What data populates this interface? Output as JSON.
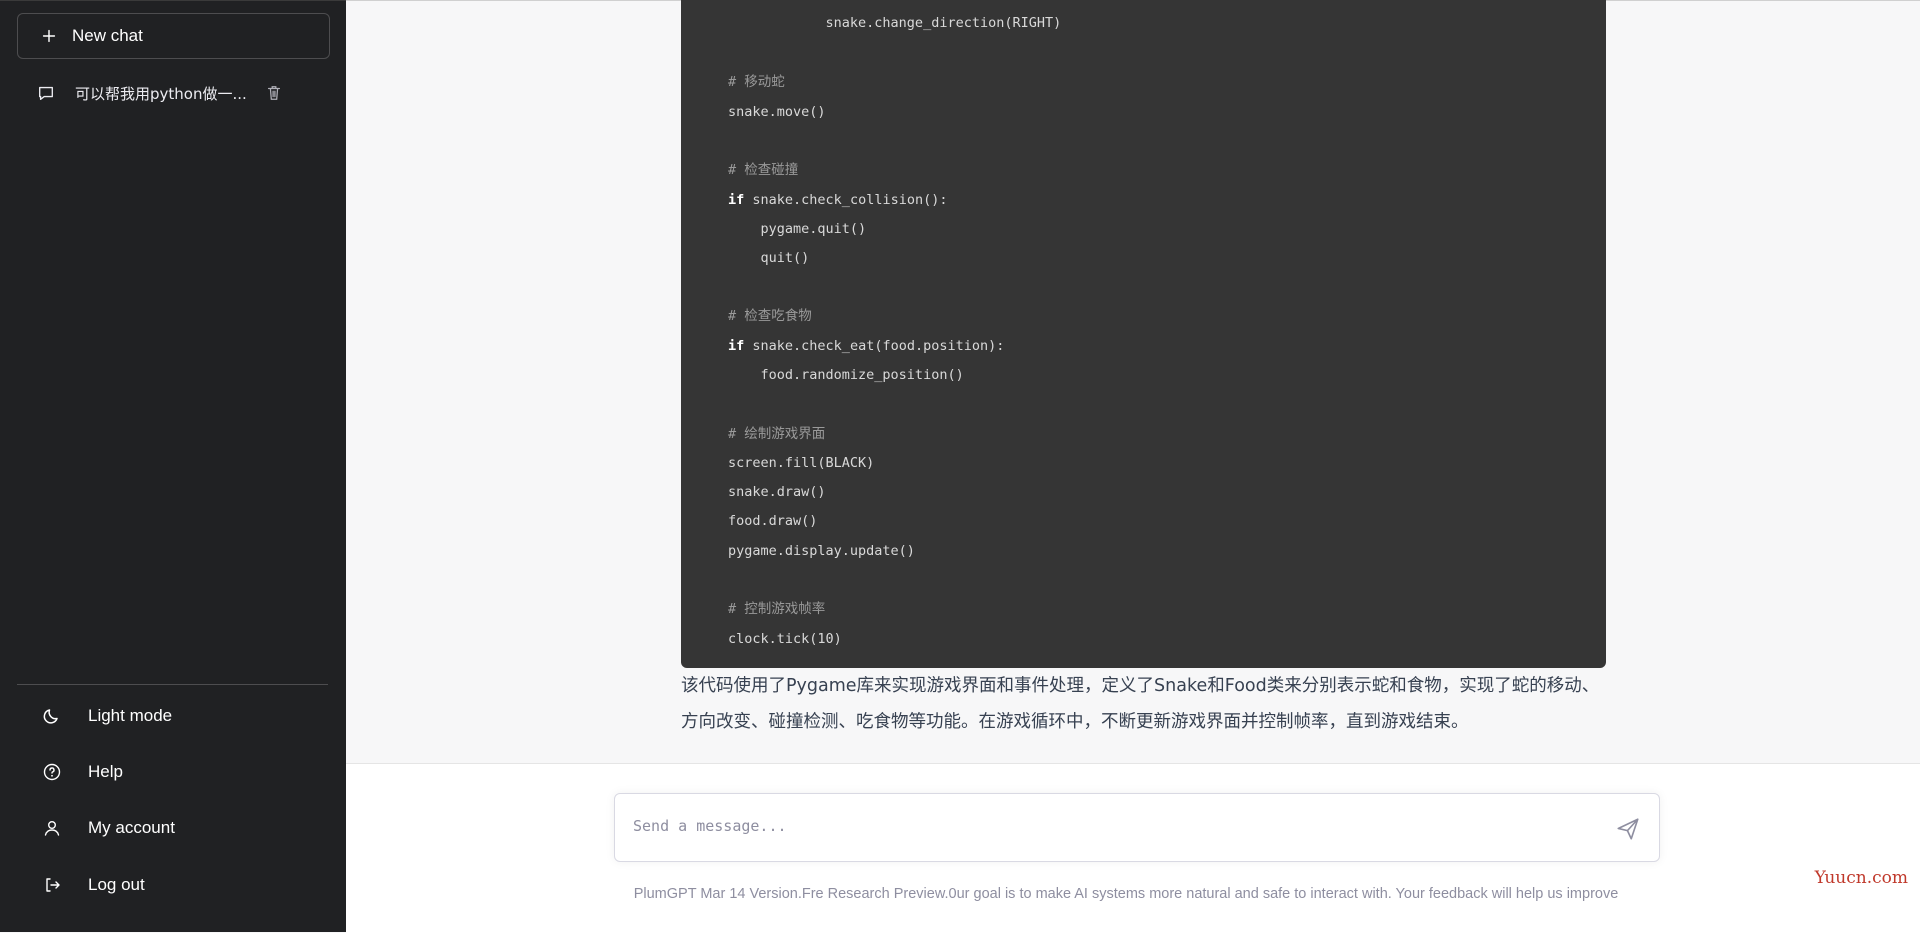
{
  "sidebar": {
    "new_chat_label": "New chat",
    "history": [
      {
        "title": "可以帮我用python做一...",
        "icon": "chat-bubble-icon",
        "action_icon": "trash-icon"
      }
    ],
    "bottom_items": [
      {
        "label": "Light mode",
        "icon": "moon-icon"
      },
      {
        "label": "Help",
        "icon": "help-circle-icon"
      },
      {
        "label": "My account",
        "icon": "user-icon"
      },
      {
        "label": "Log out",
        "icon": "logout-icon"
      }
    ]
  },
  "code": {
    "lines": [
      {
        "text": "            snake.change_direction(RIGHT)",
        "type": "code"
      },
      {
        "text": "",
        "type": "code"
      },
      {
        "text": "# 移动蛇",
        "type": "comment"
      },
      {
        "text": "snake.move()",
        "type": "code"
      },
      {
        "text": "",
        "type": "code"
      },
      {
        "text": "# 检查碰撞",
        "type": "comment"
      },
      {
        "text": "snake.check_collision():",
        "type": "if"
      },
      {
        "text": "    pygame.quit()",
        "type": "code"
      },
      {
        "text": "    quit()",
        "type": "code"
      },
      {
        "text": "",
        "type": "code"
      },
      {
        "text": "# 检查吃食物",
        "type": "comment"
      },
      {
        "text": "snake.check_eat(food.position):",
        "type": "if"
      },
      {
        "text": "    food.randomize_position()",
        "type": "code"
      },
      {
        "text": "",
        "type": "code"
      },
      {
        "text": "# 绘制游戏界面",
        "type": "comment"
      },
      {
        "text": "screen.fill(BLACK)",
        "type": "code"
      },
      {
        "text": "snake.draw()",
        "type": "code"
      },
      {
        "text": "food.draw()",
        "type": "code"
      },
      {
        "text": "pygame.display.update()",
        "type": "code"
      },
      {
        "text": "",
        "type": "code"
      },
      {
        "text": "# 控制游戏帧率",
        "type": "comment"
      },
      {
        "text": "clock.tick(10)",
        "type": "code"
      }
    ],
    "keyword": "if"
  },
  "answer": {
    "text": "该代码使用了Pygame库来实现游戏界面和事件处理，定义了Snake和Food类来分别表示蛇和食物，实现了蛇的移动、方向改变、碰撞检测、吃食物等功能。在游戏循环中，不断更新游戏界面并控制帧率，直到游戏结束。"
  },
  "composer": {
    "placeholder": "Send a message...",
    "send_icon": "send-icon"
  },
  "footer": {
    "note": "PlumGPT Mar 14 Version.Fre Research Preview.0ur goal is to make AI systems more natural and safe to interact with. Your feedback will help us improve"
  },
  "watermark": "Yuucn.com"
}
